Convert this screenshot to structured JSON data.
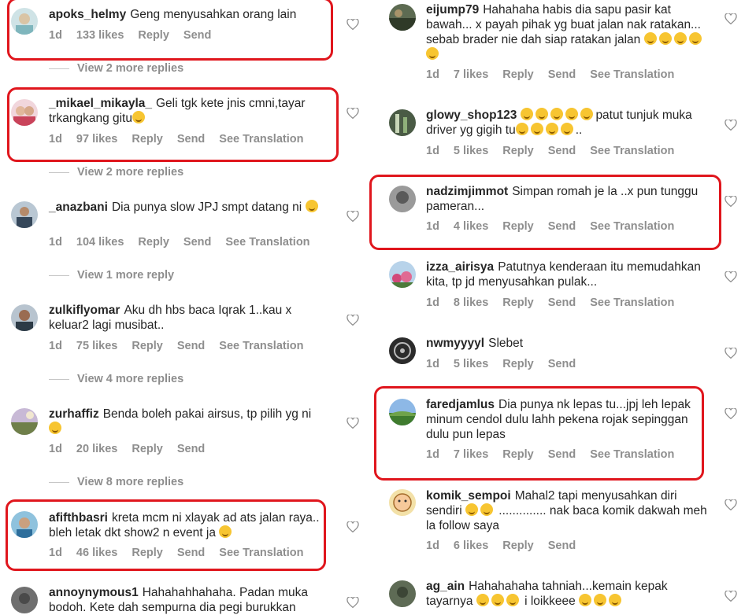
{
  "left": [
    {
      "user": "apoks_helmy",
      "text": "Geng menyusahkan orang lain",
      "time": "1d",
      "likes": "133 likes",
      "actions": [
        "Reply",
        "Send"
      ],
      "view_more": "View 2 more replies"
    },
    {
      "user": "_mikael_mikayla_",
      "text": "Geli tgk kete jnis cmni,tayar trkangkang gitu",
      "time": "1d",
      "likes": "97 likes",
      "actions": [
        "Reply",
        "Send",
        "See Translation"
      ],
      "view_more": "View 2 more replies"
    },
    {
      "user": "_anazbani",
      "text": "Dia punya slow JPJ smpt datang ni",
      "time": "1d",
      "likes": "104 likes",
      "actions": [
        "Reply",
        "Send",
        "See Translation"
      ],
      "view_more": "View 1 more reply"
    },
    {
      "user": "zulkiflyomar",
      "text": "Aku dh hbs baca Iqrak 1..kau x keluar2 lagi musibat..",
      "time": "1d",
      "likes": "75 likes",
      "actions": [
        "Reply",
        "Send",
        "See Translation"
      ],
      "view_more": "View 4 more replies"
    },
    {
      "user": "zurhaffiz",
      "text": "Benda boleh pakai airsus, tp pilih yg ni",
      "time": "1d",
      "likes": "20 likes",
      "actions": [
        "Reply",
        "Send"
      ],
      "view_more": "View 8 more replies"
    },
    {
      "user": "afifthbasri",
      "text": "kreta mcm ni xlayak ad ats jalan raya.. bleh letak dkt show2 n event ja",
      "time": "1d",
      "likes": "46 likes",
      "actions": [
        "Reply",
        "Send",
        "See Translation"
      ]
    },
    {
      "user": "annoynymous1",
      "text": "Hahahahhahaha. Padan muka bodoh. Kete dah sempurna dia pegi burukkan"
    }
  ],
  "right": [
    {
      "user": "eijump79",
      "text": "Hahahaha habis dia sapu pasir kat bawah... x payah pihak yg buat jalan nak ratakan... sebab brader nie dah siap ratakan jalan",
      "time": "1d",
      "likes": "7 likes",
      "actions": [
        "Reply",
        "Send",
        "See Translation"
      ]
    },
    {
      "user": "glowy_shop123",
      "text": "patut tunjuk muka driver yg gigih tu",
      "text_suffix": "..",
      "time": "1d",
      "likes": "5 likes",
      "actions": [
        "Reply",
        "Send",
        "See Translation"
      ]
    },
    {
      "user": "nadzimjimmot",
      "text": "Simpan romah je la ..x pun tunggu pameran...",
      "time": "1d",
      "likes": "4 likes",
      "actions": [
        "Reply",
        "Send",
        "See Translation"
      ]
    },
    {
      "user": "izza_airisya",
      "text": "Patutnya kenderaan itu memudahkan kita, tp  jd menyusahkan pulak...",
      "time": "1d",
      "likes": "8 likes",
      "actions": [
        "Reply",
        "Send",
        "See Translation"
      ]
    },
    {
      "user": "nwmyyyyl",
      "text": "Slebet",
      "time": "1d",
      "likes": "5 likes",
      "actions": [
        "Reply",
        "Send"
      ]
    },
    {
      "user": "faredjamlus",
      "text": "Dia punya nk lepas tu...jpj leh lepak minum cendol dulu lahh pekena rojak sepinggan dulu pun lepas",
      "time": "1d",
      "likes": "7 likes",
      "actions": [
        "Reply",
        "Send",
        "See Translation"
      ]
    },
    {
      "user": "komik_sempoi",
      "text": "Mahal2 tapi menyusahkan diri sendiri",
      "text_suffix": ".............. nak baca komik dakwah meh la follow saya",
      "time": "1d",
      "likes": "6 likes",
      "actions": [
        "Reply",
        "Send"
      ]
    },
    {
      "user": "ag_ain",
      "text": "Hahahahaha tahniah...kemain kepak tayarnya",
      "text_suffix": "i loikkeee"
    }
  ],
  "colors": {
    "highlight": "#e0161d",
    "meta": "#8e8e8e",
    "text": "#262626"
  }
}
